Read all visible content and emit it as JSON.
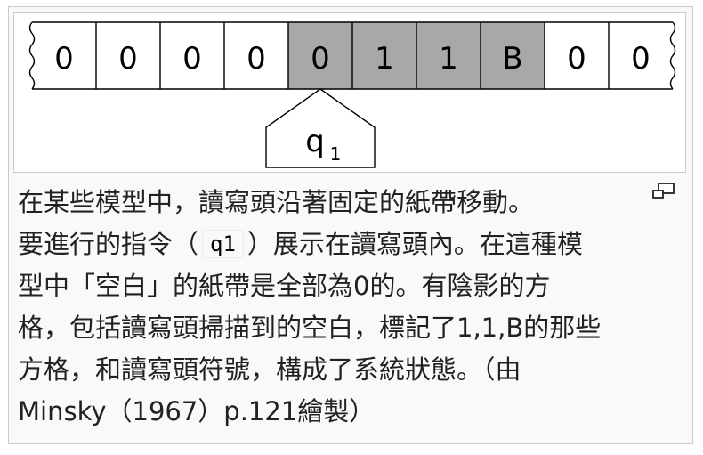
{
  "figure": {
    "tape_cells": [
      {
        "symbol": "0",
        "shaded": false
      },
      {
        "symbol": "0",
        "shaded": false
      },
      {
        "symbol": "0",
        "shaded": false
      },
      {
        "symbol": "0",
        "shaded": false
      },
      {
        "symbol": "0",
        "shaded": true
      },
      {
        "symbol": "1",
        "shaded": true
      },
      {
        "symbol": "1",
        "shaded": true
      },
      {
        "symbol": "B",
        "shaded": true
      },
      {
        "symbol": "0",
        "shaded": false
      },
      {
        "symbol": "0",
        "shaded": false
      }
    ],
    "head_state": "q",
    "head_subscript": "1",
    "colors": {
      "shaded": "#a8a8a8",
      "unshaded": "#ffffff",
      "stroke": "#000000"
    }
  },
  "caption": {
    "line1": "在某些模型中，讀寫頭沿著固定的紙帶移動。",
    "line2_before": "要進行的指令（",
    "line2_code": "q1",
    "line2_after": "）展示在讀寫頭內。在這種模",
    "line3": "型中「空白」的紙帶是全部為0的。有陰影的方",
    "line4": "格，包括讀寫頭掃描到的空白，標記了1,1,B的那些",
    "line5": "方格，和讀寫頭符號，構成了系統狀態。（由",
    "line6": "Minsky（1967）p.121繪製）"
  },
  "icons": {
    "magnify": "enlarge-icon"
  }
}
